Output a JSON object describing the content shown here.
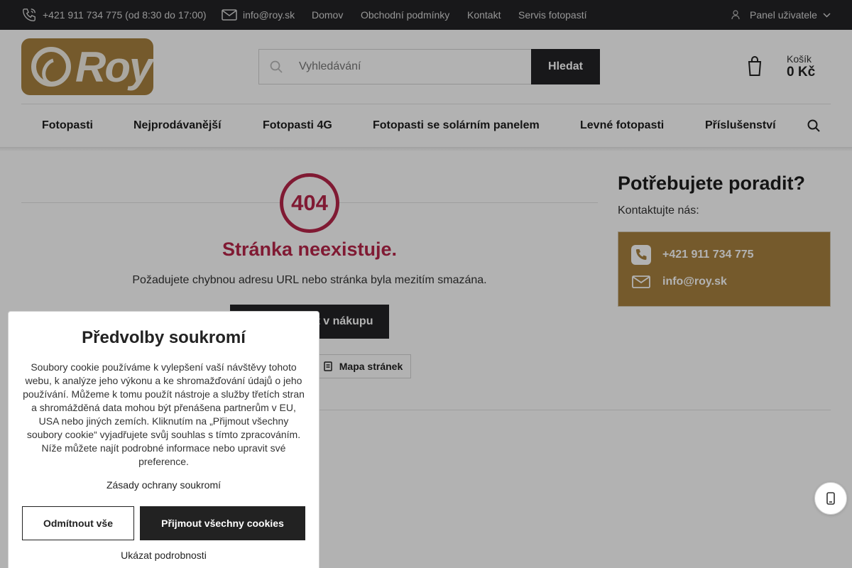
{
  "topbar": {
    "phone": "+421 911 734 775 (od 8:30 do 17:00)",
    "email": "info@roy.sk",
    "links": [
      "Domov",
      "Obchodní podmínky",
      "Kontakt",
      "Servis fotopastí"
    ],
    "user_panel": "Panel uživatele"
  },
  "header": {
    "logo_text": "Roy",
    "search_placeholder": "Vyhledávání",
    "search_button": "Hledat",
    "cart_label": "Košík",
    "cart_total": "0 Kč"
  },
  "nav": {
    "items": [
      "Fotopasti",
      "Nejprodávanější",
      "Fotopasti 4G",
      "Fotopasti se solárním panelem",
      "Levné fotopasti",
      "Příslušenství"
    ]
  },
  "error": {
    "code": "404",
    "title": "Stránka neexistuje.",
    "description": "Požadujete chybnou adresu URL nebo stránka byla mezitím smazána.",
    "continue_button": "Pokračovat v nákupu",
    "sitemap_button": "Mapa stránek"
  },
  "sidebar": {
    "title": "Potřebujete poradit?",
    "subtitle": "Kontaktujte nás:",
    "phone": "+421 911 734 775",
    "email": "info@roy.sk"
  },
  "cookie": {
    "title": "Předvolby soukromí",
    "text": "Soubory cookie používáme k vylepšení vaší návštěvy tohoto webu, k analýze jeho výkonu a ke shromažďování údajů o jeho používání. Můžeme k tomu použít nástroje a služby třetích stran a shromážděná data mohou být přenášena partnerům v EU, USA nebo jiných zemích. Kliknutím na „Přijmout všechny soubory cookie“ vyjadřujete svůj souhlas s tímto zpracováním. Níže můžete najít podrobné informace nebo upravit své preference.",
    "privacy_link": "Zásady ochrany soukromí",
    "reject_button": "Odmítnout vše",
    "accept_button": "Přijmout všechny cookies",
    "details_link": "Ukázat podrobnosti"
  },
  "colors": {
    "brand_gold": "#a8823f",
    "accent_red": "#b8264a",
    "dark": "#232326"
  }
}
